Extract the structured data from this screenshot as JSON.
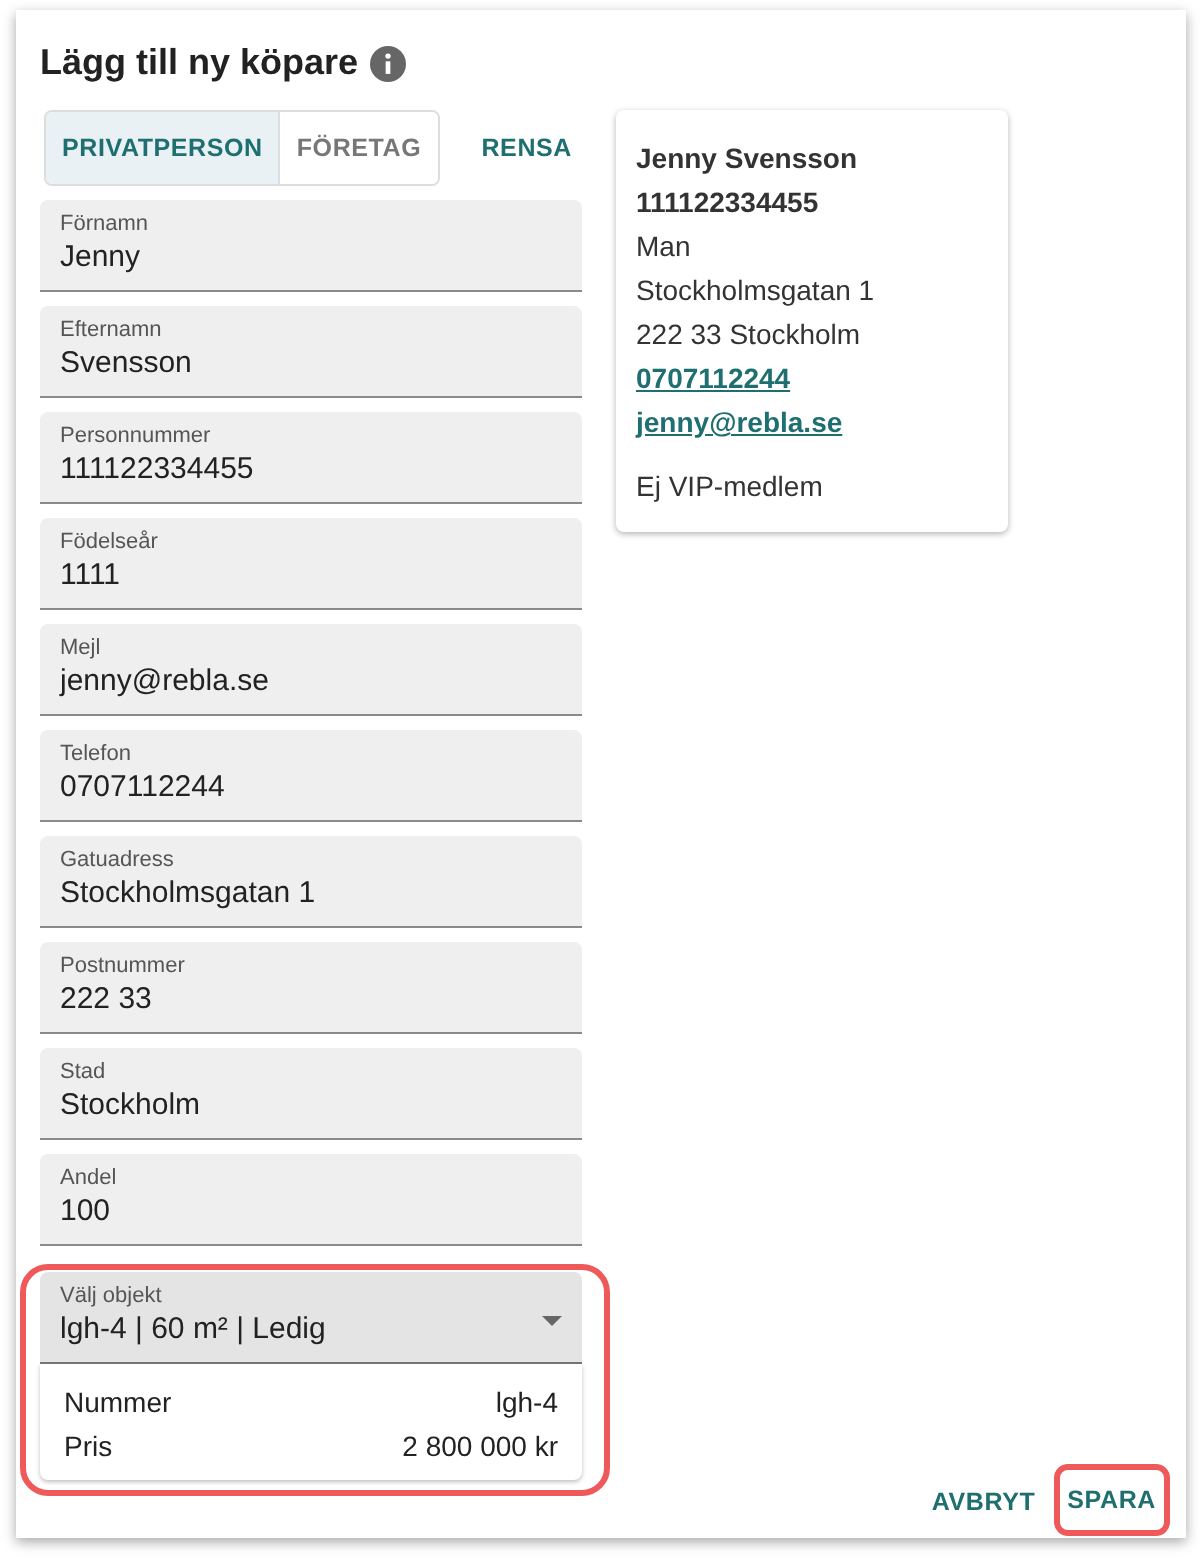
{
  "dialog": {
    "title": "Lägg till ny köpare"
  },
  "tabs": [
    {
      "label": "PRIVATPERSON",
      "selected": true
    },
    {
      "label": "FÖRETAG",
      "selected": false
    }
  ],
  "clear_button": "RENSA",
  "fields": [
    {
      "label": "Förnamn",
      "value": "Jenny"
    },
    {
      "label": "Efternamn",
      "value": "Svensson"
    },
    {
      "label": "Personnummer",
      "value": "111122334455"
    },
    {
      "label": "Födelseår",
      "value": "1111"
    },
    {
      "label": "Mejl",
      "value": "jenny@rebla.se"
    },
    {
      "label": "Telefon",
      "value": "0707112244"
    },
    {
      "label": "Gatuadress",
      "value": "Stockholmsgatan 1"
    },
    {
      "label": "Postnummer",
      "value": "222 33"
    },
    {
      "label": "Stad",
      "value": "Stockholm"
    },
    {
      "label": "Andel",
      "value": "100"
    }
  ],
  "object_select": {
    "label": "Välj objekt",
    "value": "lgh-4 | 60 m² | Ledig",
    "highlighted": true,
    "details": [
      {
        "key": "Nummer",
        "value": "lgh-4"
      },
      {
        "key": "Pris",
        "value": "2 800 000 kr"
      }
    ]
  },
  "summary_card": {
    "lines": [
      {
        "kind": "bold",
        "text": "Jenny Svensson"
      },
      {
        "kind": "bold",
        "text": "111122334455"
      },
      {
        "kind": "plain",
        "text": "Man"
      },
      {
        "kind": "plain",
        "text": "Stockholmsgatan 1"
      },
      {
        "kind": "plain",
        "text": "222 33 Stockholm"
      },
      {
        "kind": "link",
        "text": "0707112244"
      },
      {
        "kind": "link",
        "text": "jenny@rebla.se"
      },
      {
        "kind": "note",
        "text": "Ej VIP-medlem"
      }
    ]
  },
  "actions": [
    {
      "label": "AVBRYT",
      "highlighted": false
    },
    {
      "label": "SPARA",
      "highlighted": true
    }
  ]
}
